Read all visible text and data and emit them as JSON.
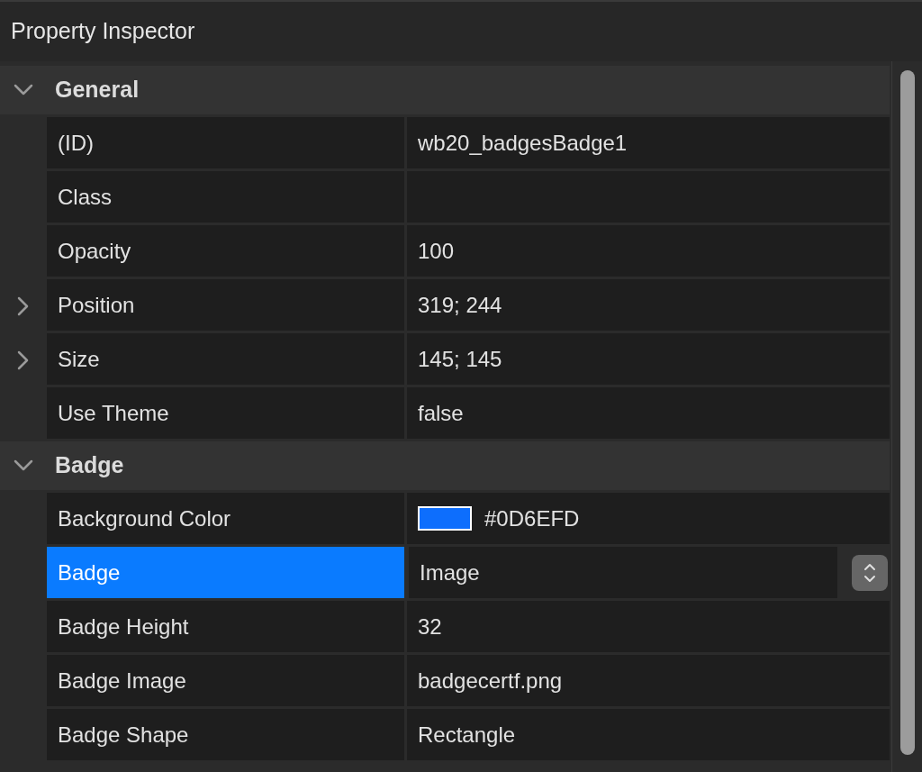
{
  "window": {
    "title": "Property Inspector"
  },
  "sections": [
    {
      "title": "General",
      "expanded": true,
      "rows": [
        {
          "kind": "text",
          "name": "(ID)",
          "value": "wb20_badgesBadge1",
          "selected": false
        },
        {
          "kind": "text",
          "name": "Class",
          "selected": false
        },
        {
          "kind": "text",
          "name": "Opacity",
          "value": "100",
          "selected": false
        },
        {
          "kind": "text",
          "name": "Position",
          "value": "319; 244",
          "selected": false,
          "expanded": false
        },
        {
          "kind": "text",
          "name": "Size",
          "value": "145; 145",
          "selected": false,
          "expanded": false
        },
        {
          "kind": "text",
          "name": "Use Theme",
          "value": "false",
          "selected": false
        }
      ]
    },
    {
      "title": "Badge",
      "expanded": true,
      "rows": [
        {
          "kind": "color",
          "name": "Background Color",
          "value": "#0D6EFD",
          "color": "#0d6efd",
          "selected": false
        },
        {
          "kind": "select",
          "name": "Badge",
          "value": "Image",
          "selected": true
        },
        {
          "kind": "text",
          "name": "Badge Height",
          "value": "32",
          "selected": false
        },
        {
          "kind": "text",
          "name": "Badge Image",
          "value": "badgecertf.png",
          "selected": false
        },
        {
          "kind": "text",
          "name": "Badge Shape",
          "value": "Rectangle",
          "selected": false
        }
      ]
    }
  ]
}
